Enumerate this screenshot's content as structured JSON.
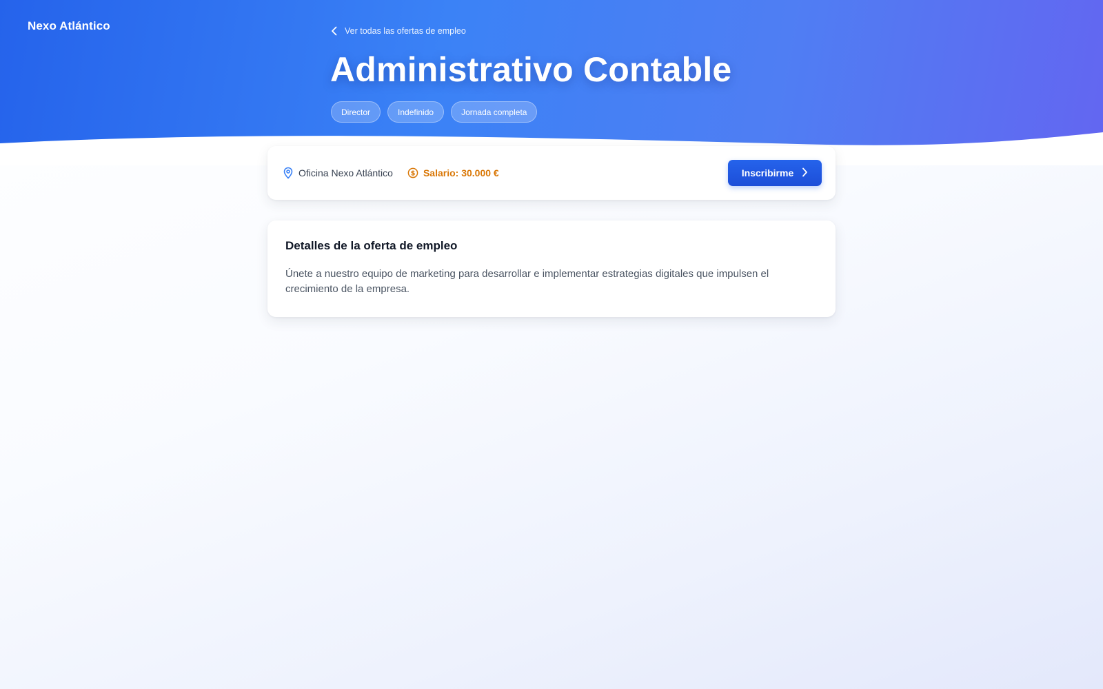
{
  "header": {
    "brand": "Nexo Atlántico",
    "back_link": "Ver todas las ofertas de empleo",
    "title": "Administrativo Contable",
    "tags": [
      "Director",
      "Indefinido",
      "Jornada completa"
    ]
  },
  "info": {
    "location": "Oficina Nexo Atlántico",
    "salary": "Salario: 30.000 €",
    "apply_label": "Inscribirme"
  },
  "details": {
    "heading": "Detalles de la oferta de empleo",
    "description": "Únete a nuestro equipo de marketing para desarrollar e implementar estrategias digitales que impulsen el crecimiento de la empresa."
  },
  "colors": {
    "hero_start": "#2563eb",
    "hero_end": "#6366f1",
    "accent": "#1d4ed8",
    "salary": "#d97706",
    "location_icon": "#3b82f6"
  },
  "icons": {
    "back": "chevron-left-icon",
    "location": "map-pin-icon",
    "salary": "dollar-circle-icon",
    "apply": "chevron-right-icon"
  }
}
